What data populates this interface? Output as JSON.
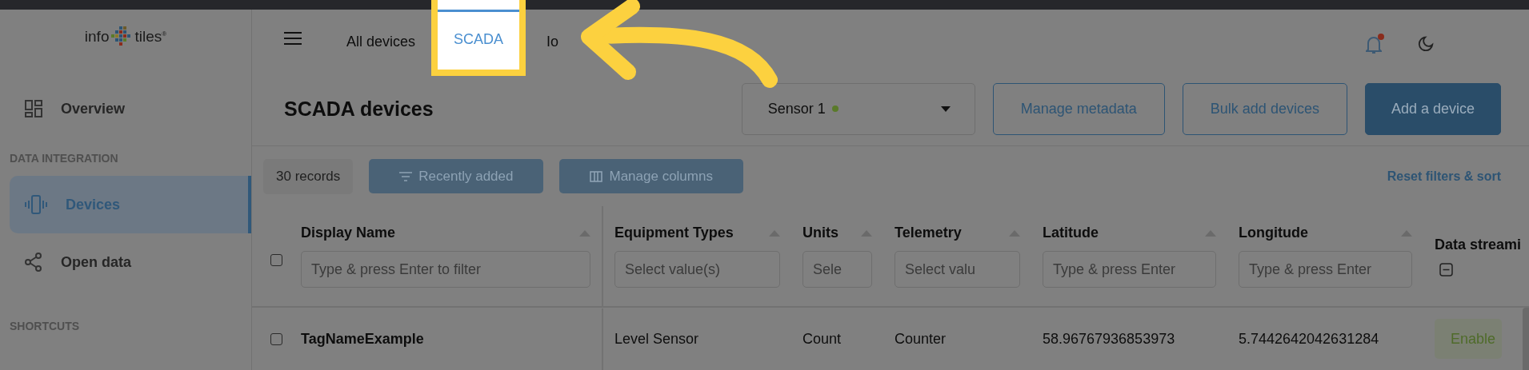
{
  "sidebar": {
    "logo": {
      "left": "info",
      "right": "tiles$^{®}$"
    },
    "items": [
      {
        "kind": "link",
        "label": "Overview",
        "selected": false
      },
      {
        "kind": "section",
        "label": "DATA INTEGRATION"
      },
      {
        "kind": "link",
        "label": "Devices",
        "selected": true
      },
      {
        "kind": "link",
        "label": "Open data",
        "selected": false
      },
      {
        "kind": "section",
        "label": "SHORTCUTS"
      }
    ]
  },
  "tabs": [
    {
      "label": "All devices",
      "selected": false,
      "highlighted": false
    },
    {
      "label": "SCADA",
      "selected": true,
      "highlighted": true
    },
    {
      "label": "Io",
      "selected": false,
      "highlighted": false
    }
  ],
  "notifications": {
    "unread": true
  },
  "header": {
    "title": "SCADA devices",
    "source_select": {
      "value": "Sensor 1",
      "color": "#5a7a2a"
    },
    "buttons": [
      {
        "kind": "outline",
        "label": "Manage metadata"
      },
      {
        "kind": "outline",
        "label": "Bulk add devices"
      },
      {
        "kind": "primary",
        "label": "Add a device"
      }
    ]
  },
  "toolbar": {
    "count": "30 records",
    "buttons": [
      "Recently added",
      "Manage columns"
    ],
    "reset": "Reset filters & sort"
  },
  "table": {
    "header_checked": false,
    "columns": [
      {
        "label": "Display Name",
        "kind": "text",
        "placeholder": "Type & press Enter to filter",
        "sortable": true
      },
      {
        "label": "Equipment Types",
        "kind": "text",
        "placeholder": "Select value(s)",
        "sortable": true
      },
      {
        "label": "Units",
        "kind": "text",
        "placeholder": "Sele",
        "sortable": true
      },
      {
        "label": "Telemetry",
        "kind": "text",
        "placeholder": "Select valu",
        "sortable": true
      },
      {
        "label": "Latitude",
        "kind": "text",
        "placeholder": "Type & press Enter",
        "sortable": true
      },
      {
        "label": "Longitude",
        "kind": "text",
        "placeholder": "Type & press Enter",
        "sortable": true
      },
      {
        "label": "Data streami",
        "kind": "toggle",
        "sortable": false
      }
    ],
    "rows": [
      {
        "checked": false,
        "cells": [
          "TagNameExample",
          "Level Sensor",
          "Count",
          "Counter",
          "58.96767936853973",
          "5.7442642042631284"
        ],
        "streaming": "Enable"
      }
    ]
  },
  "annotation": {
    "arrow": true
  }
}
